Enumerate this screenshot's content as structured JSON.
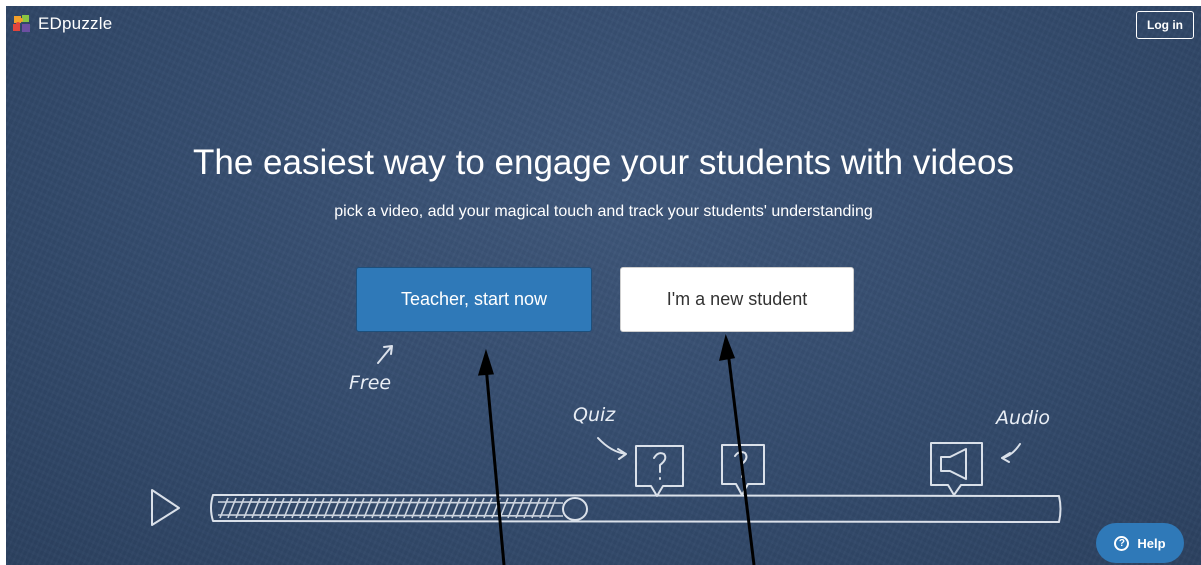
{
  "brand": {
    "name": "EDpuzzle"
  },
  "header": {
    "login_label": "Log in"
  },
  "hero": {
    "title": "The easiest way to engage your students with videos",
    "subtitle": "pick a video, add your magical touch and track your students' understanding",
    "teacher_button": "Teacher, start now",
    "student_button": "I'm a new student"
  },
  "chalk_labels": {
    "free": "Free",
    "quiz": "Quiz",
    "audio": "Audio",
    "question_mark": "?"
  },
  "help": {
    "label": "Help",
    "icon_glyph": "?"
  },
  "colors": {
    "background": "#344b6d",
    "primary": "#2f79b8",
    "chalk": "#e9eef5"
  }
}
